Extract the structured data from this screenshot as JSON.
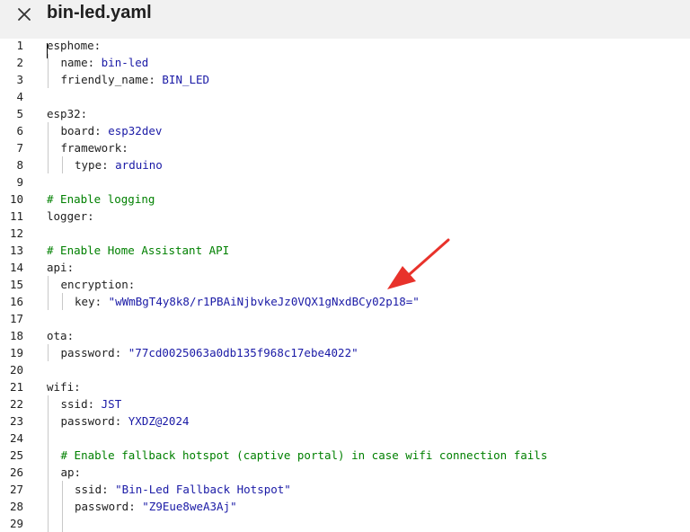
{
  "window": {
    "title": "bin-led.yaml",
    "close_icon": "close-icon"
  },
  "editor": {
    "lines": [
      {
        "num": "1",
        "indent": 0,
        "key": "esphome:",
        "value": "",
        "kind": "key"
      },
      {
        "num": "2",
        "indent": 1,
        "key": "name: ",
        "value": "bin-led",
        "kind": "kv"
      },
      {
        "num": "3",
        "indent": 1,
        "key": "friendly_name: ",
        "value": "BIN_LED",
        "kind": "kv"
      },
      {
        "num": "4",
        "indent": 0,
        "key": "",
        "value": "",
        "kind": "blank"
      },
      {
        "num": "5",
        "indent": 0,
        "key": "esp32:",
        "value": "",
        "kind": "key"
      },
      {
        "num": "6",
        "indent": 1,
        "key": "board: ",
        "value": "esp32dev",
        "kind": "kv"
      },
      {
        "num": "7",
        "indent": 1,
        "key": "framework:",
        "value": "",
        "kind": "key"
      },
      {
        "num": "8",
        "indent": 2,
        "key": "type: ",
        "value": "arduino",
        "kind": "kv"
      },
      {
        "num": "9",
        "indent": 0,
        "key": "",
        "value": "",
        "kind": "blank"
      },
      {
        "num": "10",
        "indent": 0,
        "key": "",
        "value": "# Enable logging",
        "kind": "comment"
      },
      {
        "num": "11",
        "indent": 0,
        "key": "logger:",
        "value": "",
        "kind": "key"
      },
      {
        "num": "12",
        "indent": 0,
        "key": "",
        "value": "",
        "kind": "blank"
      },
      {
        "num": "13",
        "indent": 0,
        "key": "",
        "value": "# Enable Home Assistant API",
        "kind": "comment"
      },
      {
        "num": "14",
        "indent": 0,
        "key": "api:",
        "value": "",
        "kind": "key"
      },
      {
        "num": "15",
        "indent": 1,
        "key": "encryption:",
        "value": "",
        "kind": "key"
      },
      {
        "num": "16",
        "indent": 2,
        "key": "key: ",
        "value": "\"wWmBgT4y8k8/r1PBAiNjbvkeJz0VQX1gNxdBCy02p18=\"",
        "kind": "kv"
      },
      {
        "num": "17",
        "indent": 0,
        "key": "",
        "value": "",
        "kind": "blank"
      },
      {
        "num": "18",
        "indent": 0,
        "key": "ota:",
        "value": "",
        "kind": "key"
      },
      {
        "num": "19",
        "indent": 1,
        "key": "password: ",
        "value": "\"77cd0025063a0db135f968c17ebe4022\"",
        "kind": "kv"
      },
      {
        "num": "20",
        "indent": 0,
        "key": "",
        "value": "",
        "kind": "blank"
      },
      {
        "num": "21",
        "indent": 0,
        "key": "wifi:",
        "value": "",
        "kind": "key"
      },
      {
        "num": "22",
        "indent": 1,
        "key": "ssid: ",
        "value": "JST",
        "kind": "kv"
      },
      {
        "num": "23",
        "indent": 1,
        "key": "password: ",
        "value": "YXDZ@2024",
        "kind": "kv"
      },
      {
        "num": "24",
        "indent": 0,
        "key": "",
        "value": "",
        "kind": "blank"
      },
      {
        "num": "25",
        "indent": 1,
        "key": "",
        "value": "# Enable fallback hotspot (captive portal) in case wifi connection fails",
        "kind": "comment"
      },
      {
        "num": "26",
        "indent": 1,
        "key": "ap:",
        "value": "",
        "kind": "key"
      },
      {
        "num": "27",
        "indent": 2,
        "key": "ssid: ",
        "value": "\"Bin-Led Fallback Hotspot\"",
        "kind": "kv"
      },
      {
        "num": "28",
        "indent": 2,
        "key": "password: ",
        "value": "\"Z9Eue8weA3Aj\"",
        "kind": "kv"
      },
      {
        "num": "29",
        "indent": 0,
        "key": "",
        "value": "",
        "kind": "blank"
      }
    ]
  },
  "annotation": {
    "arrow_color": "#e8322b",
    "arrow_icon": "red-arrow-annotation"
  }
}
